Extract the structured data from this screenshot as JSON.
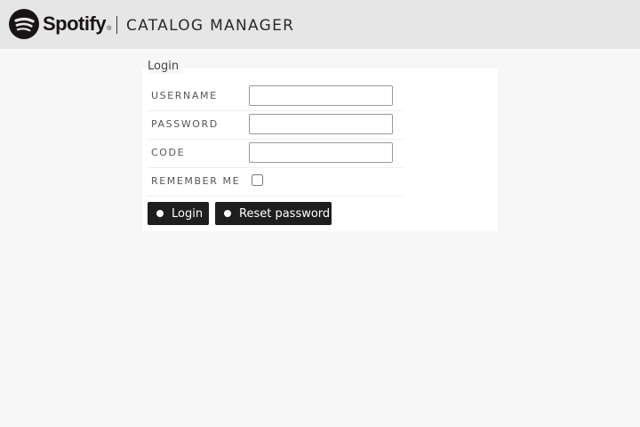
{
  "header": {
    "brand": "Spotify",
    "brand_mark": "®",
    "title": "CATALOG MANAGER"
  },
  "form": {
    "legend": "Login",
    "fields": [
      {
        "label": "USERNAME",
        "type": "text",
        "value": ""
      },
      {
        "label": "PASSWORD",
        "type": "password",
        "value": ""
      },
      {
        "label": "CODE",
        "type": "text",
        "value": ""
      },
      {
        "label": "REMEMBER ME",
        "type": "checkbox",
        "checked": false
      }
    ],
    "buttons": {
      "login": "Login",
      "reset": "Reset password"
    }
  },
  "colors": {
    "header_bg": "#e6e6e6",
    "page_bg": "#f7f7f7",
    "button_bg": "#1e1e1e"
  }
}
